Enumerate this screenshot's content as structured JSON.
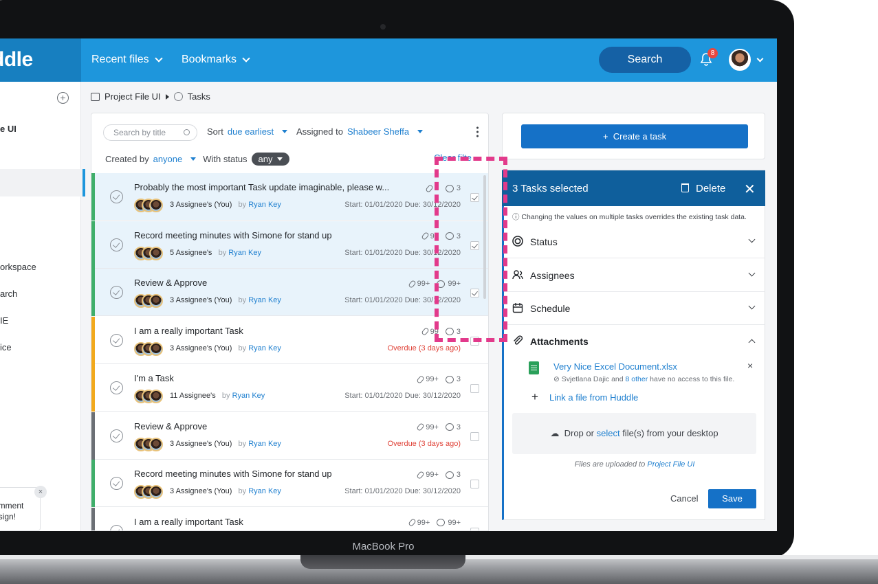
{
  "device": {
    "label": "MacBook Pro"
  },
  "topbar": {
    "brand": "ddle",
    "nav": [
      {
        "label": "Recent files"
      },
      {
        "label": "Bookmarks"
      }
    ],
    "search_label": "Search",
    "notification_count": "8"
  },
  "sidebar": {
    "items": [
      {
        "label": "e UI"
      },
      {
        "label": "orkspace"
      },
      {
        "label": "arch"
      },
      {
        "label": "IE"
      },
      {
        "label": "ice"
      }
    ],
    "toast_text": [
      "omment",
      "esign!"
    ],
    "toast_close": "×"
  },
  "breadcrumb": {
    "project": "Project File UI",
    "page": "Tasks"
  },
  "filters": {
    "search_placeholder": "Search by title",
    "sort_label": "Sort",
    "sort_value": "due earliest",
    "assigned_label": "Assigned to",
    "assigned_value": "Shabeer Sheffa",
    "created_label": "Created by",
    "created_value": "anyone",
    "status_label": "With status",
    "status_value": "any",
    "clear_label": "Clear filte"
  },
  "tasks": [
    {
      "title": "Probably the most important Task update imaginable, please w...",
      "assignees": "3 Assignee's (You)",
      "by": "by",
      "owner": "Ryan Key",
      "attachments": "1",
      "comments": "3",
      "dates": "Start: 01/01/2020 Due: 30/12/2020",
      "overdue": false,
      "selected": true,
      "bar_color": "#3fae6a"
    },
    {
      "title": "Record meeting minutes with Simone for stand up",
      "assignees": "5 Assignee's",
      "by": "by",
      "owner": "Ryan Key",
      "attachments": "99",
      "comments": "3",
      "dates": "Start: 01/01/2020 Due: 30/12/2020",
      "overdue": false,
      "selected": true,
      "bar_color": "#3fae6a"
    },
    {
      "title": "Review & Approve",
      "assignees": "3 Assignee's (You)",
      "by": "by",
      "owner": "Ryan Key",
      "attachments": "99+",
      "comments": "99+",
      "dates": "Start: 01/01/2020 Due: 30/12/2020",
      "overdue": false,
      "selected": true,
      "bar_color": "#3fae6a"
    },
    {
      "title": "I am a really important Task",
      "assignees": "3 Assignee's (You)",
      "by": "by",
      "owner": "Ryan Key",
      "attachments": "99",
      "comments": "3",
      "dates": "Overdue (3 days ago)",
      "overdue": true,
      "selected": false,
      "bar_color": "#f2a91c"
    },
    {
      "title": "I'm a Task",
      "assignees": "11 Assignee's",
      "by": "by",
      "owner": "Ryan Key",
      "attachments": "99+",
      "comments": "3",
      "dates": "Start: 01/01/2020 Due: 30/12/2020",
      "overdue": false,
      "selected": false,
      "bar_color": "#f2a91c"
    },
    {
      "title": "Review & Approve",
      "assignees": "3 Assignee's (You)",
      "by": "by",
      "owner": "Ryan Key",
      "attachments": "99+",
      "comments": "3",
      "dates": "Overdue (3 days ago)",
      "overdue": true,
      "selected": false,
      "bar_color": "#6b6f75"
    },
    {
      "title": "Record meeting minutes with Simone for stand up",
      "assignees": "3 Assignee's (You)",
      "by": "by",
      "owner": "Ryan Key",
      "attachments": "99+",
      "comments": "3",
      "dates": "Start: 01/01/2020 Due: 30/12/2020",
      "overdue": false,
      "selected": false,
      "bar_color": "#3fae6a"
    },
    {
      "title": "I am a really important Task",
      "assignees": "",
      "by": "",
      "owner": "",
      "attachments": "99+",
      "comments": "99+",
      "dates": "",
      "overdue": false,
      "selected": false,
      "bar_color": "#6b6f75"
    }
  ],
  "create": {
    "label": "Create a task",
    "plus": "+"
  },
  "bulk": {
    "title": "3 Tasks selected",
    "delete_label": "Delete",
    "close": "✕",
    "note": "Changing the values on multiple tasks overrides the existing task data.",
    "sections": [
      {
        "label": "Status",
        "icon": "status-icon",
        "expanded": false
      },
      {
        "label": "Assignees",
        "icon": "people-icon",
        "expanded": false
      },
      {
        "label": "Schedule",
        "icon": "calendar-icon",
        "expanded": false
      },
      {
        "label": "Attachments",
        "icon": "paperclip-icon",
        "expanded": true
      }
    ],
    "attachment": {
      "name": "Very Nice Excel Document.xlsx",
      "remove": "×",
      "note_prefix": "Svjetlana Dajic and",
      "note_link": "8 other",
      "note_suffix": "have no access to this file."
    },
    "link_file": "Link a file from Huddle",
    "drop_prefix": "Drop or",
    "drop_link": "select",
    "drop_suffix": "file(s) from your desktop",
    "upload_note_prefix": "Files are uploaded to",
    "upload_note_link": "Project File UI",
    "cancel_label": "Cancel",
    "save_label": "Save"
  },
  "colors": {
    "brand": "#1e96dc",
    "brand_dark": "#0f5f9c",
    "highlight": "#e23a8b",
    "overdue": "#e0453b"
  }
}
